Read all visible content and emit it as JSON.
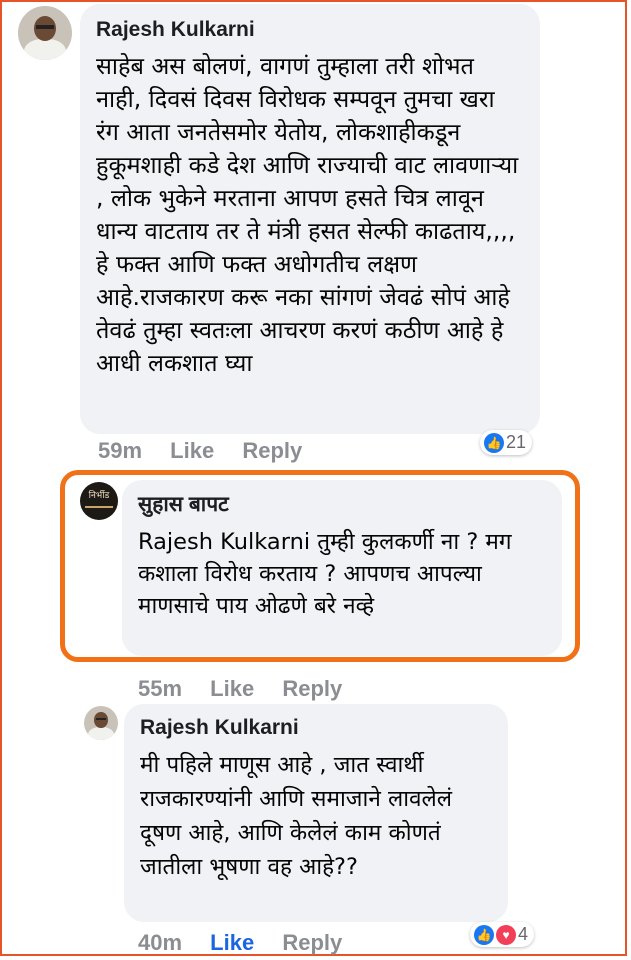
{
  "comments": [
    {
      "author": "Rajesh Kulkarni",
      "text": "साहेब अस बोलणं, वागणं तुम्हाला तरी शोभत नाही, दिवसं दिवस विरोधक सम्पवून तुमचा खरा रंग आता जनतेसमोर येतोय, लोकशाहीकडून हुकूमशाही कडे देश आणि राज्याची वाट लावणाऱ्या , लोक भुकेने मरताना आपण हसते चित्र लावून धान्य वाटताय तर ते मंत्री हसत सेल्फी काढताय,,,, हे फक्त आणि फक्त अधोगतीच लक्षण आहे.राजकारण करू नका सांगणं जेवढं सोपं आहे तेवढं तुम्हा स्वतःला आचरण करणं कठीण आहे हे आधी लकशात घ्या",
      "time": "59m",
      "like_label": "Like",
      "reply_label": "Reply",
      "reaction_count": "21",
      "reaction_icons": [
        "like-icon"
      ]
    },
    {
      "author": "सुहास बापट",
      "text": "Rajesh Kulkarni  तुम्ही कुलकर्णी ना ? मग कशाला विरोध करताय ? आपणच आपल्या माणसाचे पाय ओढणे बरे नव्हे",
      "time": "55m",
      "like_label": "Like",
      "reply_label": "Reply",
      "avatar_logo_text": "निर्भीड"
    },
    {
      "author": "Rajesh Kulkarni",
      "text": "मी पहिले माणूस आहे , जात स्वार्थी राजकारण्यांनी आणि  समाजाने लावलेलं दूषण आहे,  आणि केलेलं काम कोणतं जातीला भूषणा वह आहे??",
      "time": "40m",
      "like_label": "Like",
      "reply_label": "Reply",
      "liked": true,
      "reaction_count": "4",
      "reaction_icons": [
        "like-icon",
        "love-icon"
      ]
    }
  ],
  "colors": {
    "highlight_border": "#f07118",
    "like_active": "#1b66e0",
    "bubble_bg": "#f0f2f5",
    "meta_text": "#8a8d91"
  }
}
